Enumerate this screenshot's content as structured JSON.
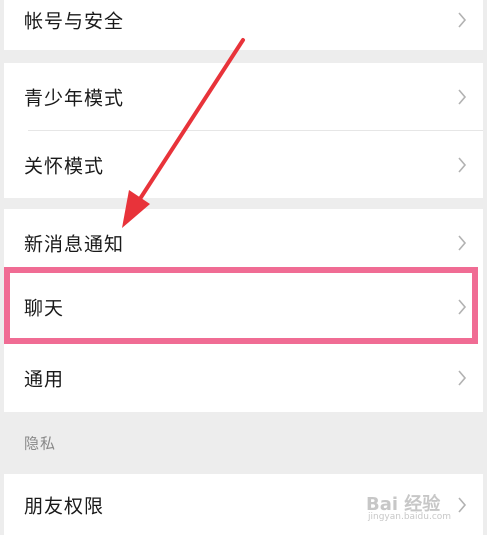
{
  "settings": {
    "items": [
      {
        "label": "帐号与安全"
      },
      {
        "label": "青少年模式"
      },
      {
        "label": "关怀模式"
      },
      {
        "label": "新消息通知"
      },
      {
        "label": "聊天"
      },
      {
        "label": "通用"
      }
    ],
    "privacy_section": {
      "header": "隐私",
      "items": [
        {
          "label": "朋友权限"
        }
      ]
    }
  },
  "annotation": {
    "highlight_color": "#f06c94",
    "arrow_color": "#e8333a"
  },
  "watermark": {
    "brand": "Bai 经验",
    "url": "jingyan.baidu.com"
  },
  "icons": {
    "chevron": "chevron-right-icon"
  }
}
